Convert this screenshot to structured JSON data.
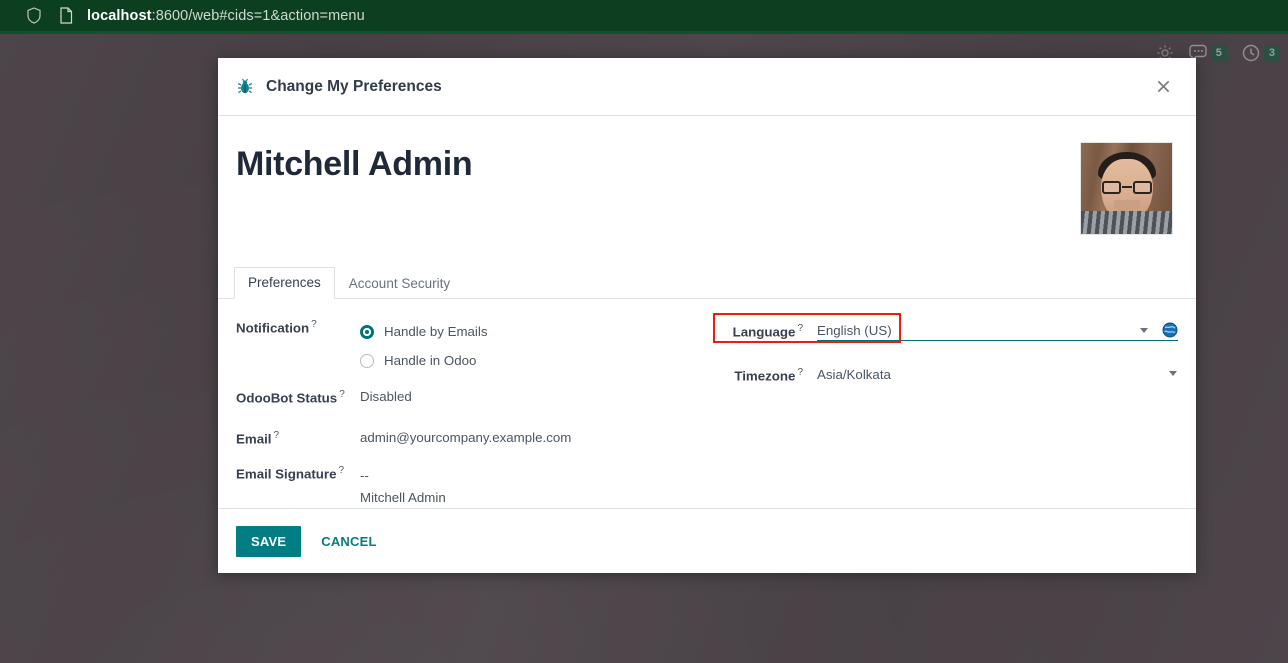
{
  "browser": {
    "url_host": "localhost",
    "url_path": ":8600/web#cids=1&action=menu",
    "shield_icon": "shield-icon",
    "page_icon": "page-icon"
  },
  "systray": {
    "settings_icon": "gear-icon",
    "items": [
      {
        "icon": "messages-icon",
        "badge": "5"
      },
      {
        "icon": "activities-clock-icon",
        "badge": "3"
      }
    ]
  },
  "dialog": {
    "icon": "bug-icon",
    "title": "Change My Preferences",
    "close_label": "×",
    "record_name": "Mitchell Admin",
    "avatar_alt": "user-avatar",
    "tabs": [
      {
        "label": "Preferences",
        "active": true
      },
      {
        "label": "Account Security",
        "active": false
      }
    ],
    "fields_left": {
      "notification_label": "Notification",
      "notification_help": "?",
      "notification_options": [
        {
          "label": "Handle by Emails",
          "selected": true
        },
        {
          "label": "Handle in Odoo",
          "selected": false
        }
      ],
      "odoobot_label": "OdooBot Status",
      "odoobot_help": "?",
      "odoobot_value": "Disabled",
      "email_label": "Email",
      "email_help": "?",
      "email_value": "admin@yourcompany.example.com",
      "signature_label": "Email Signature",
      "signature_help": "?",
      "signature_line1": "--",
      "signature_line2": "Mitchell Admin"
    },
    "fields_right": {
      "language_label": "Language",
      "language_help": "?",
      "language_value": "English (US)",
      "language_globe_icon": "globe-icon",
      "language_caret_icon": "chevron-down-icon",
      "timezone_label": "Timezone",
      "timezone_help": "?",
      "timezone_value": "Asia/Kolkata",
      "timezone_caret_icon": "chevron-down-icon"
    },
    "footer": {
      "save_label": "SAVE",
      "cancel_label": "CANCEL"
    }
  },
  "colors": {
    "accent_teal": "#017e84",
    "radio_teal": "#00737c",
    "highlight_red": "#f01c12",
    "urlbar_green": "#0c3f1f",
    "backdrop": "#4a4247"
  }
}
